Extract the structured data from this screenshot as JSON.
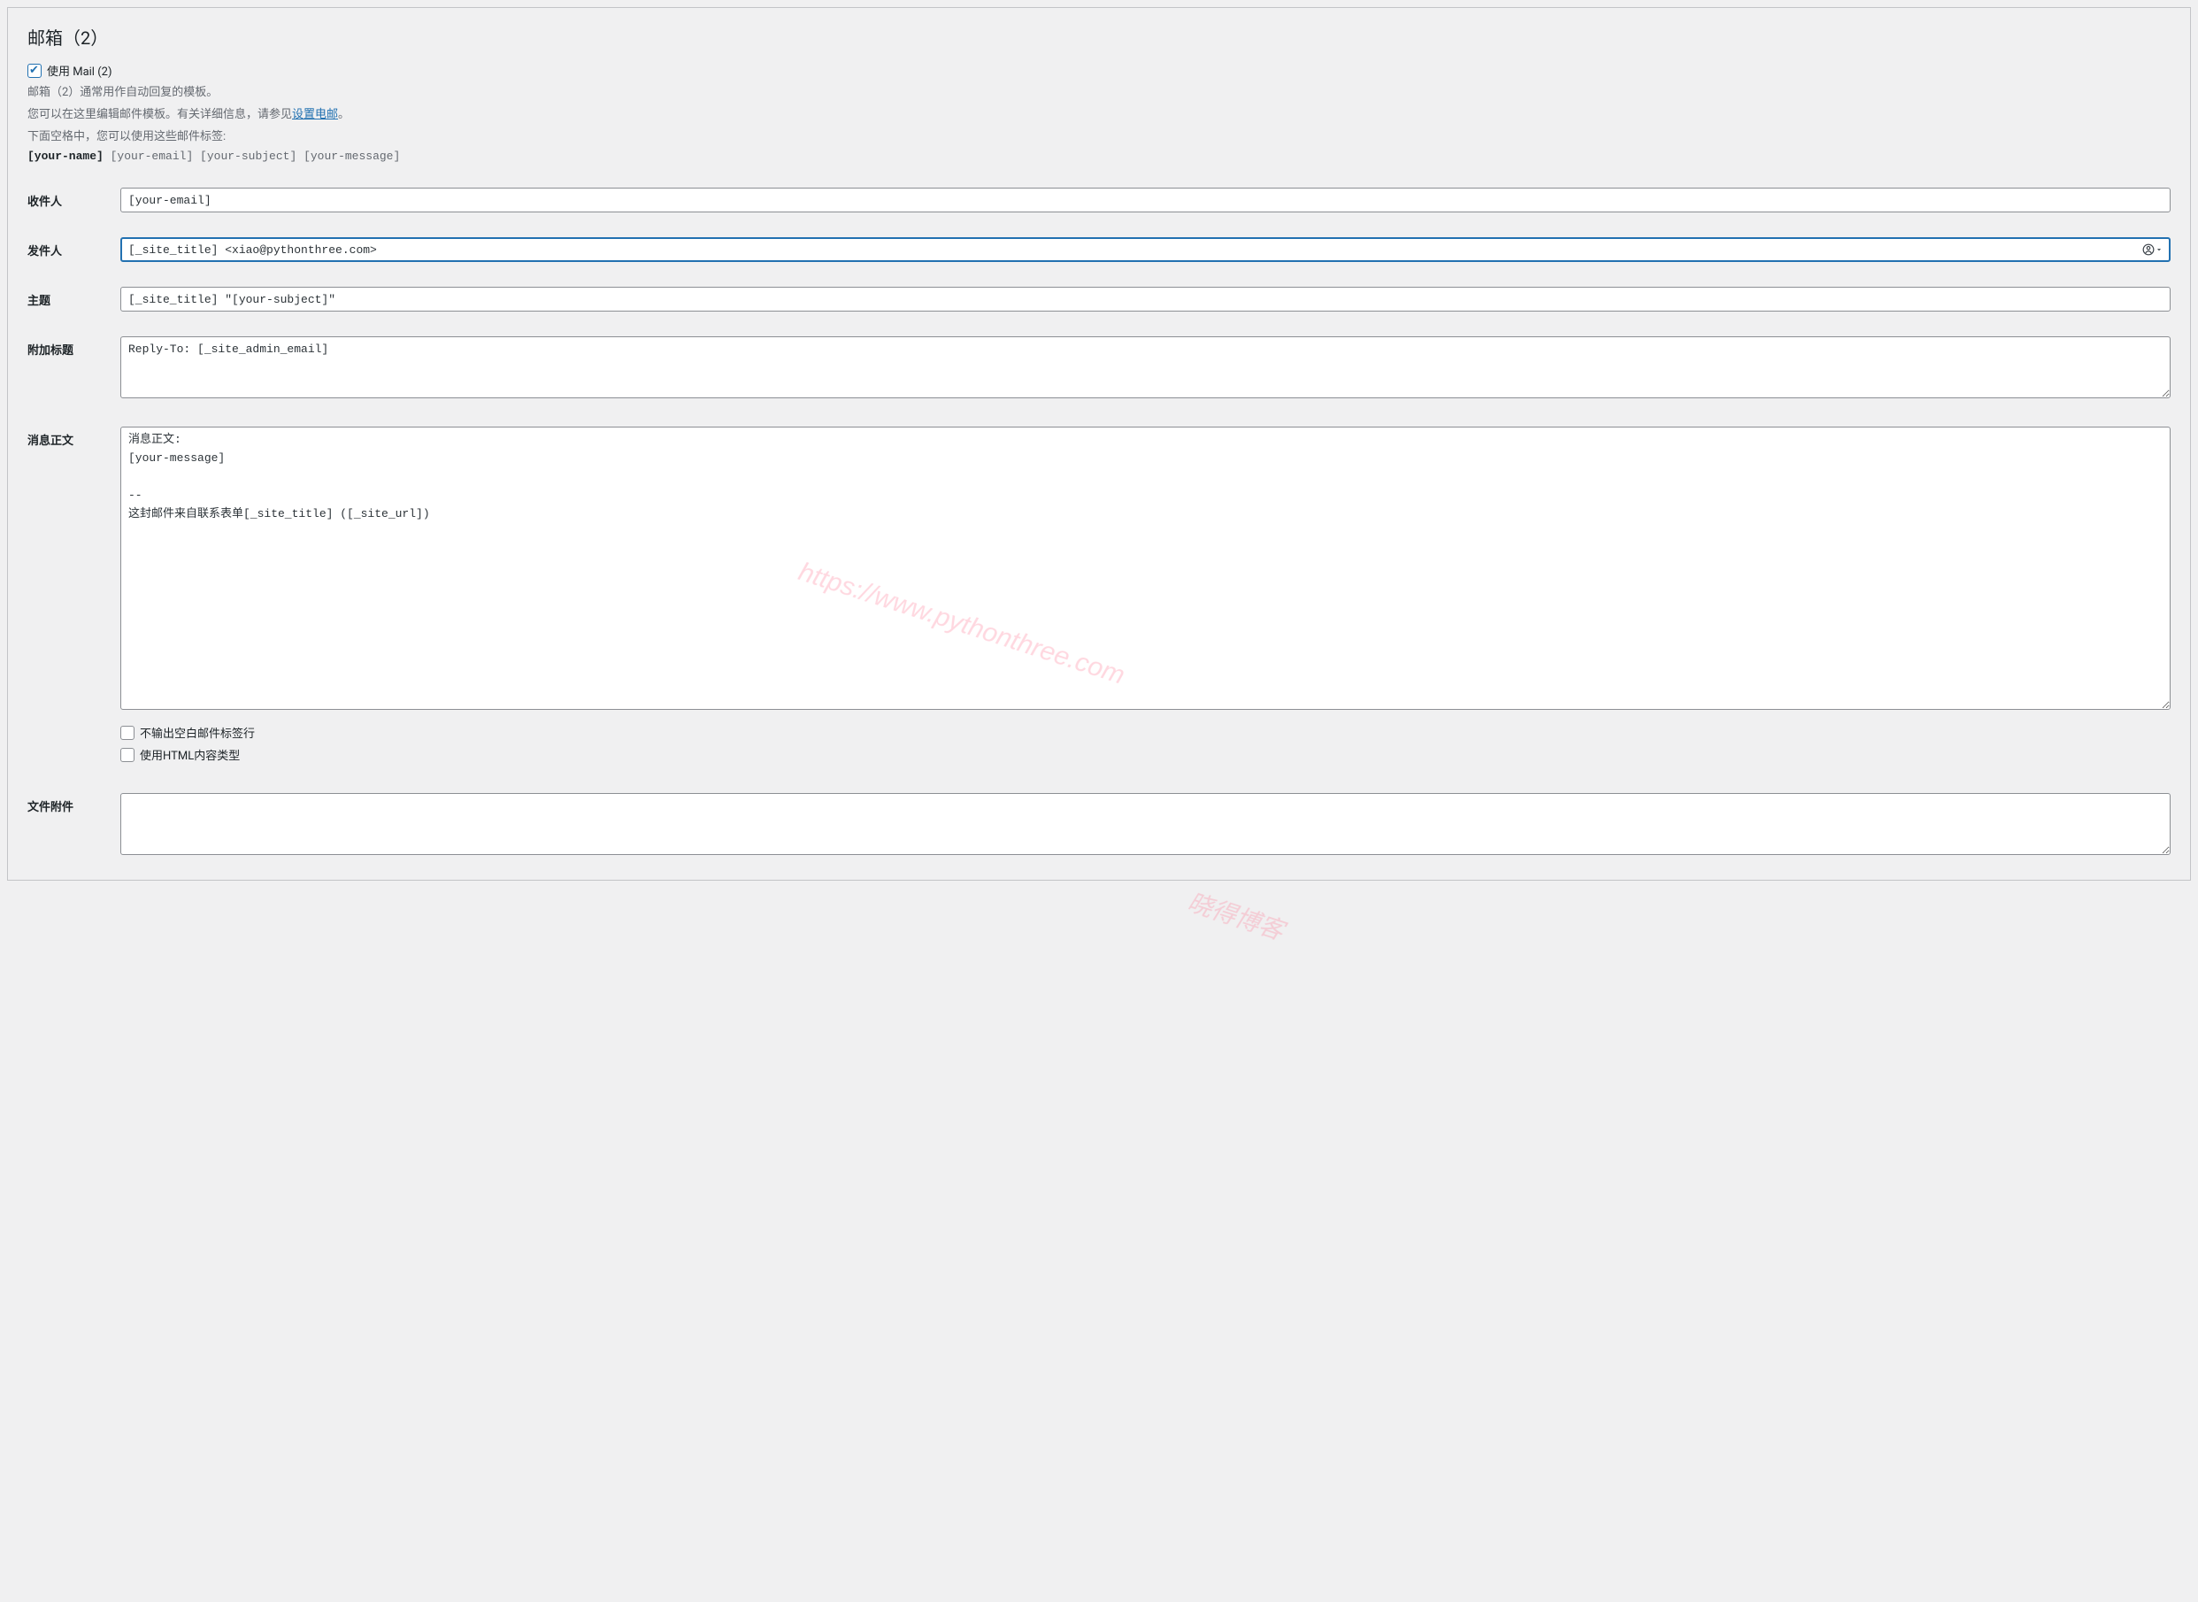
{
  "section_title": "邮箱（2）",
  "use_mail2_label": "使用 Mail (2)",
  "desc_line1": "邮箱（2）通常用作自动回复的模板。",
  "desc_line2_prefix": "您可以在这里编辑邮件模板。有关详细信息，请参见",
  "desc_link": "设置电邮",
  "desc_line2_suffix": "。",
  "tags_prefix": "下面空格中，您可以使用这些邮件标签:",
  "tags": {
    "bold": "[your-name]",
    "rest": " [your-email] [your-subject] [your-message]"
  },
  "fields": {
    "recipient": {
      "label": "收件人",
      "value": "[your-email]"
    },
    "sender": {
      "label": "发件人",
      "value": "[_site_title] <xiao@pythonthree.com>"
    },
    "subject": {
      "label": "主题",
      "value": "[_site_title] \"[your-subject]\""
    },
    "additional_headers": {
      "label": "附加标题",
      "value": "Reply-To: [_site_admin_email]"
    },
    "message_body": {
      "label": "消息正文",
      "value": "消息正文:\n[your-message]\n\n-- \n这封邮件来自联系表单[_site_title] ([_site_url])"
    },
    "exclude_blank": "不输出空白邮件标签行",
    "use_html": "使用HTML内容类型",
    "attachments": {
      "label": "文件附件",
      "value": ""
    }
  },
  "watermark1": "https://www.pythonthree.com",
  "watermark2": "晓得博客"
}
